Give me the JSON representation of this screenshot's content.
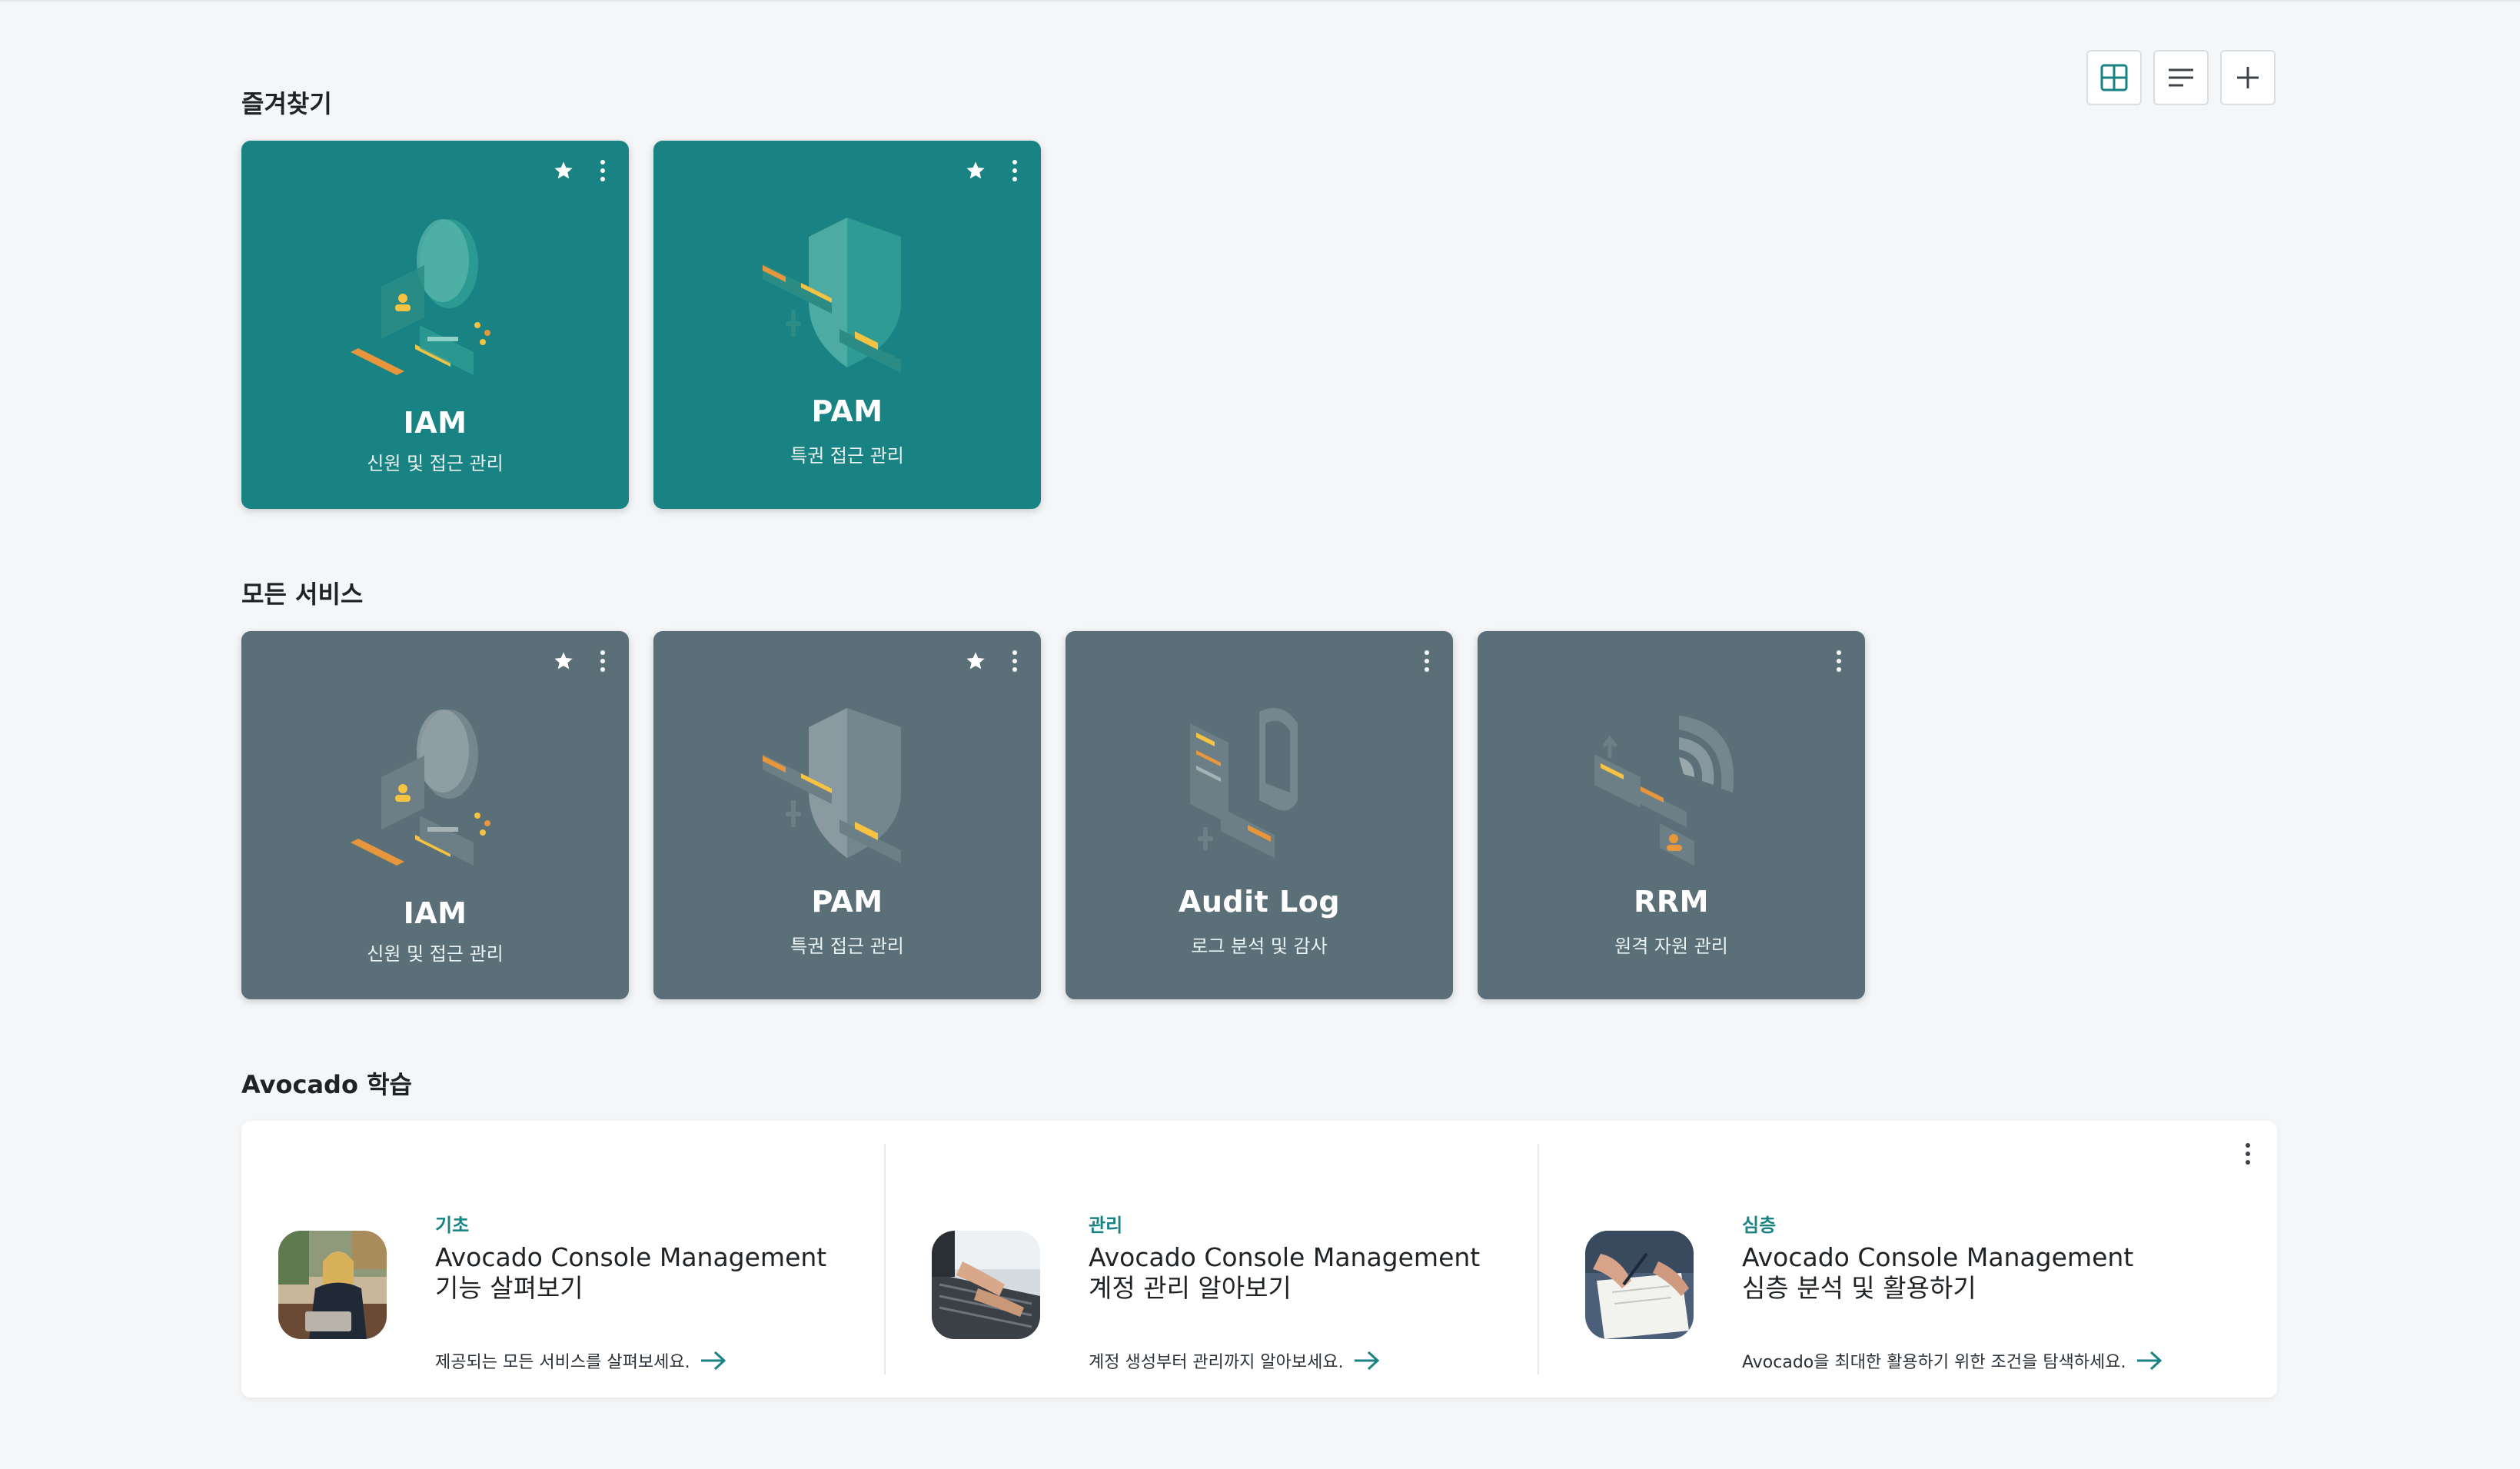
{
  "toolbar": {
    "buttons": [
      {
        "name": "grid-view-button",
        "icon": "grid-icon"
      },
      {
        "name": "list-view-button",
        "icon": "list-icon"
      },
      {
        "name": "add-button",
        "icon": "plus-icon"
      }
    ],
    "accent": "#198282"
  },
  "favorites": {
    "title": "즐겨찾기",
    "cards": [
      {
        "name": "IAM",
        "desc": "신원 및 접근 관리",
        "starred": true,
        "illustration": "iam-illustration-icon"
      },
      {
        "name": "PAM",
        "desc": "특권 접근 관리",
        "starred": true,
        "illustration": "pam-illustration-icon"
      }
    ]
  },
  "all_services": {
    "title": "모든 서비스",
    "cards": [
      {
        "name": "IAM",
        "desc": "신원 및 접근 관리",
        "starred": true,
        "illustration": "iam-illustration-icon"
      },
      {
        "name": "PAM",
        "desc": "특권 접근 관리",
        "starred": true,
        "illustration": "pam-illustration-icon"
      },
      {
        "name": "Audit Log",
        "desc": "로그 분석 및 감사",
        "starred": false,
        "illustration": "audit-log-illustration-icon"
      },
      {
        "name": "RRM",
        "desc": "원격 자원 관리",
        "starred": false,
        "illustration": "rrm-illustration-icon"
      }
    ]
  },
  "learning": {
    "title": "Avocado 학습",
    "items": [
      {
        "level": "기초",
        "title_line1": "Avocado Console Management",
        "title_line2": "기능 살펴보기",
        "desc": "제공되는 모든 서비스를 살펴보세요."
      },
      {
        "level": "관리",
        "title_line1": "Avocado Console Management",
        "title_line2": "계정 관리 알아보기",
        "desc": "계정 생성부터 관리까지 알아보세요."
      },
      {
        "level": "심층",
        "title_line1": "Avocado Console Management",
        "title_line2": "심층 분석 및 활용하기",
        "desc": "Avocado을 최대한 활용하기 위한 조건을 탐색하세요."
      }
    ]
  },
  "colors": {
    "favorite_card": "#198282",
    "service_card": "#5b6f78",
    "background": "#f4f6f8"
  }
}
